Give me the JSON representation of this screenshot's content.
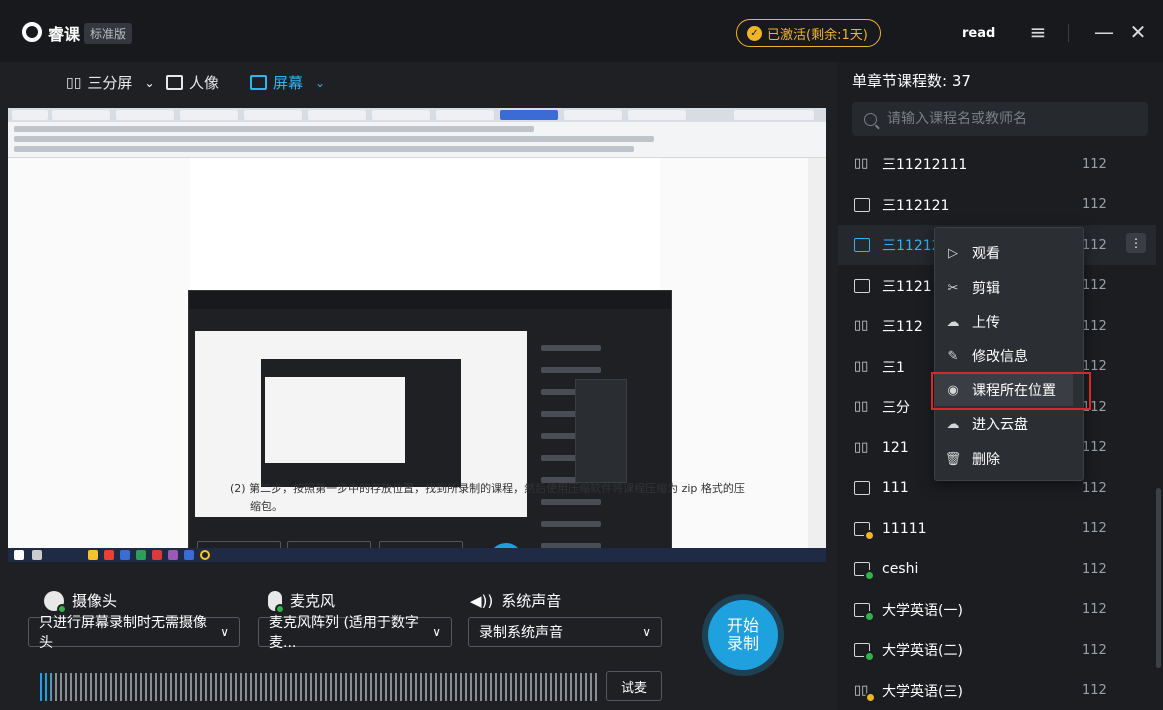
{
  "titlebar": {
    "app_name": "睿课",
    "edition": "标准版",
    "activation": "已激活(剩余:1天)",
    "username": "read",
    "menu_icon": "hamburger-icon",
    "minimize_icon": "minimize-icon",
    "close_icon": "close-icon"
  },
  "modes": {
    "split": "三分屏",
    "portrait": "人像",
    "screen": "屏幕"
  },
  "colors": {
    "accent": "#2fb5f2",
    "activated": "#f0b429",
    "highlight_box": "#d8282a",
    "start_button": "#1ea1de"
  },
  "preview": {
    "doc_step_text": "(2)    第二步，按照第一步中的存放位置，找到所录制的课程，然后使用压缩软件将课程压缩为 zip 格式的压",
    "doc_step_text2": "缩包。"
  },
  "devices": {
    "camera_label": "摄像头",
    "camera_value": "只进行屏幕录制时无需摄像头",
    "mic_label": "麦克风",
    "mic_value": "麦克风阵列 (适用于数字麦...",
    "sound_label": "系统声音",
    "sound_value": "录制系统声音",
    "start_label_1": "开始",
    "start_label_2": "录制",
    "test_mic": "试麦",
    "mic_level": 0.02
  },
  "panel": {
    "title": "单章节课程数: 37",
    "search_placeholder": "请输入课程名或教师名",
    "courses": [
      {
        "icon": "split-layout-icon",
        "name": "三11212111",
        "count": "112"
      },
      {
        "icon": "screen-icon",
        "name": "三112121",
        "count": "112"
      },
      {
        "icon": "screen-icon",
        "name": "三11212",
        "count": "112"
      },
      {
        "icon": "screen-icon",
        "name": "三1121",
        "count": "112"
      },
      {
        "icon": "split-layout-icon",
        "name": "三112",
        "count": "112"
      },
      {
        "icon": "split-layout-icon",
        "name": "三1",
        "count": "112"
      },
      {
        "icon": "split-layout-icon",
        "name": "三分",
        "count": "112"
      },
      {
        "icon": "split-layout-icon",
        "name": "121",
        "count": "112"
      },
      {
        "icon": "screen-icon",
        "name": "111",
        "count": "112"
      },
      {
        "icon": "screen-icon-uploading",
        "name": "11111",
        "count": "112"
      },
      {
        "icon": "screen-icon-uploaded",
        "name": "ceshi",
        "count": "112"
      },
      {
        "icon": "screen-icon-uploaded",
        "name": "大学英语(一)",
        "count": "112"
      },
      {
        "icon": "screen-icon-uploaded",
        "name": "大学英语(二)",
        "count": "112"
      },
      {
        "icon": "split-icon-uploading",
        "name": "大学英语(三)",
        "count": "112"
      }
    ]
  },
  "context_menu": {
    "watch": "观看",
    "edit": "剪辑",
    "upload": "上传",
    "modify": "修改信息",
    "location": "课程所在位置",
    "cloud": "进入云盘",
    "delete": "删除"
  }
}
